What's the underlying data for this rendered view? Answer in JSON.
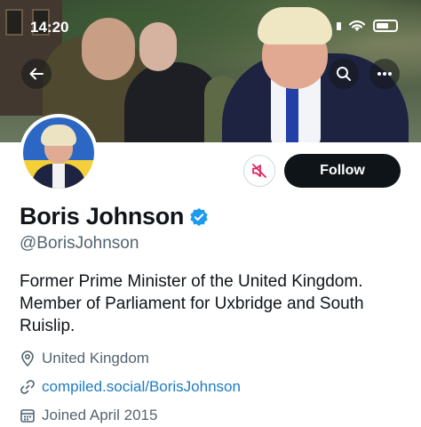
{
  "status_bar": {
    "time": "14:20"
  },
  "header": {
    "back_icon": "arrow-left-icon",
    "search_icon": "search-icon",
    "more_icon": "more-horizontal-icon"
  },
  "profile": {
    "display_name": "Boris Johnson",
    "handle": "@BorisJohnson",
    "verified": true,
    "bio_line1": "Former Prime Minister of the United Kingdom.",
    "bio_line2": "Member of Parliament for Uxbridge and South",
    "bio_line3": "Ruislip.",
    "location": "United Kingdom",
    "website": "compiled.social/BorisJohnson",
    "joined": "Joined April 2015"
  },
  "actions": {
    "follow_label": "Follow",
    "mute_icon": "muted-speaker-icon"
  },
  "colors": {
    "accent": "#1d9bf0",
    "link": "#1d7bc4",
    "follow_bg": "#0f1419",
    "mute_icon": "#e0245e",
    "secondary_text": "#536471"
  }
}
